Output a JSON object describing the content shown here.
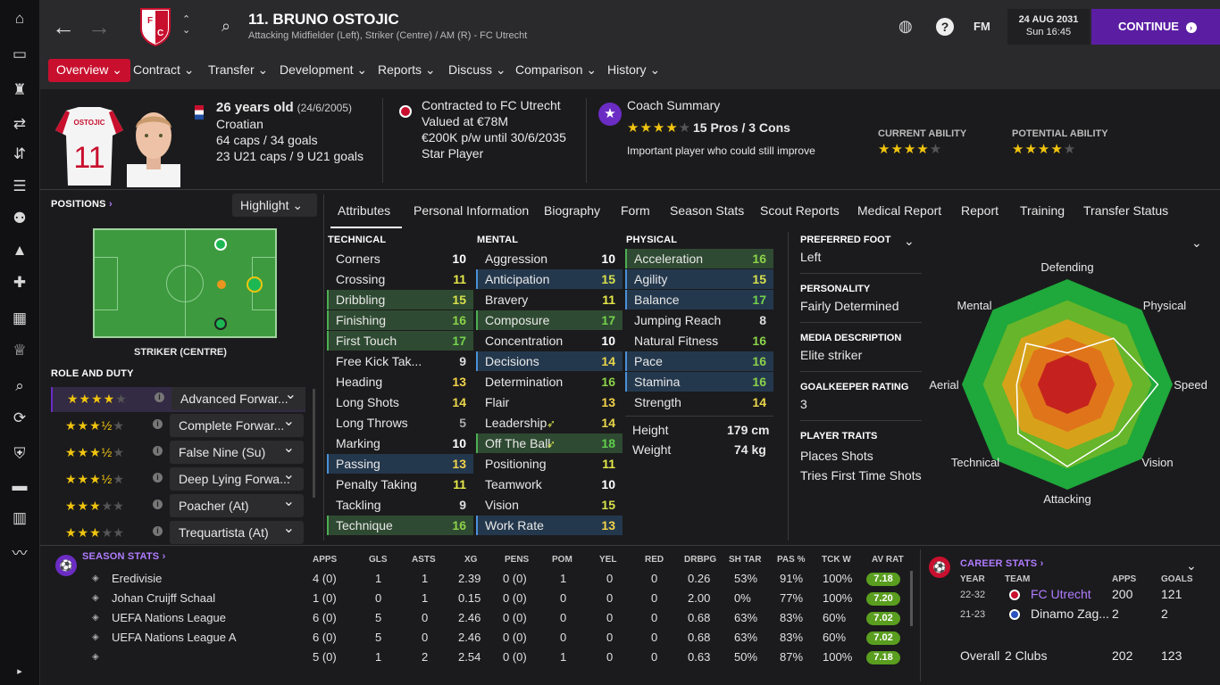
{
  "header": {
    "title": "11. BRUNO OSTOJIC",
    "subtitle": "Attacking Midfielder (Left), Striker (Centre) / AM (R) - FC Utrecht",
    "fm_label": "FM",
    "date": "24 AUG 2031",
    "time": "Sun 16:45",
    "continue_label": "CONTINUE"
  },
  "tabs": [
    "Overview",
    "Contract",
    "Transfer",
    "Development",
    "Reports",
    "Discuss",
    "Comparison",
    "History"
  ],
  "profile": {
    "shirt_name": "OSTOJIC",
    "shirt_number": "11",
    "age": "26 years old",
    "dob": "(24/6/2005)",
    "nationality": "Croatian",
    "caps": "64 caps / 34 goals",
    "u21_caps": "23 U21 caps / 9 U21 goals",
    "contract": "Contracted to FC Utrecht",
    "value": "Valued at €78M",
    "wage": "€200K p/w until 30/6/2035",
    "status": "Star Player",
    "coach_title": "Coach Summary",
    "coach_stars": "★★★★",
    "coach_stars_dim": "★",
    "pros_cons": "15 Pros / 3 Cons",
    "coach_note": "Important player who could still improve",
    "ca_label": "CURRENT ABILITY",
    "pa_label": "POTENTIAL ABILITY",
    "ca_stars": "★★★★",
    "ca_dim": "★",
    "pa_stars": "★★★★",
    "pa_dim": "★",
    "ca_value": 4,
    "pa_value": 4
  },
  "positions": {
    "title": "POSITIONS",
    "highlight": "Highlight",
    "position_label": "STRIKER (CENTRE)",
    "role_title": "ROLE AND DUTY",
    "roles": [
      {
        "stars": "★★★★",
        "dim": "★",
        "name": "Advanced Forwar..."
      },
      {
        "stars": "★★★½",
        "dim": "★",
        "name": "Complete Forwar..."
      },
      {
        "stars": "★★★½",
        "dim": "★",
        "name": "False Nine (Su)"
      },
      {
        "stars": "★★★½",
        "dim": "★",
        "name": "Deep Lying Forwa..."
      },
      {
        "stars": "★★★",
        "dim": "★★",
        "name": "Poacher (At)"
      },
      {
        "stars": "★★★",
        "dim": "★★",
        "name": "Trequartista (At)"
      }
    ]
  },
  "subtabs": [
    "Attributes",
    "Personal Information",
    "Biography",
    "Form",
    "Season Stats",
    "Scout Reports",
    "Medical Report",
    "Report",
    "Training",
    "Transfer Status"
  ],
  "technical": {
    "title": "TECHNICAL",
    "rows": [
      {
        "n": "Corners",
        "v": "10",
        "h": ""
      },
      {
        "n": "Crossing",
        "v": "11",
        "h": ""
      },
      {
        "n": "Dribbling",
        "v": "15",
        "h": "g"
      },
      {
        "n": "Finishing",
        "v": "16",
        "h": "g"
      },
      {
        "n": "First Touch",
        "v": "17",
        "h": "g"
      },
      {
        "n": "Free Kick Tak...",
        "v": "9",
        "h": ""
      },
      {
        "n": "Heading",
        "v": "13",
        "h": ""
      },
      {
        "n": "Long Shots",
        "v": "14",
        "h": ""
      },
      {
        "n": "Long Throws",
        "v": "5",
        "h": ""
      },
      {
        "n": "Marking",
        "v": "10",
        "h": ""
      },
      {
        "n": "Passing",
        "v": "13",
        "h": "b"
      },
      {
        "n": "Penalty Taking",
        "v": "11",
        "h": ""
      },
      {
        "n": "Tackling",
        "v": "9",
        "h": ""
      },
      {
        "n": "Technique",
        "v": "16",
        "h": "g"
      }
    ]
  },
  "mental": {
    "title": "MENTAL",
    "rows": [
      {
        "n": "Aggression",
        "v": "10",
        "h": ""
      },
      {
        "n": "Anticipation",
        "v": "15",
        "h": "b"
      },
      {
        "n": "Bravery",
        "v": "11",
        "h": ""
      },
      {
        "n": "Composure",
        "v": "17",
        "h": "g"
      },
      {
        "n": "Concentration",
        "v": "10",
        "h": ""
      },
      {
        "n": "Decisions",
        "v": "14",
        "h": "b"
      },
      {
        "n": "Determination",
        "v": "16",
        "h": ""
      },
      {
        "n": "Flair",
        "v": "13",
        "h": ""
      },
      {
        "n": "Leadership",
        "v": "14",
        "h": ""
      },
      {
        "n": "Off The Ball",
        "v": "18",
        "h": "g"
      },
      {
        "n": "Positioning",
        "v": "11",
        "h": ""
      },
      {
        "n": "Teamwork",
        "v": "10",
        "h": ""
      },
      {
        "n": "Vision",
        "v": "15",
        "h": ""
      },
      {
        "n": "Work Rate",
        "v": "13",
        "h": "b"
      }
    ]
  },
  "physical": {
    "title": "PHYSICAL",
    "rows": [
      {
        "n": "Acceleration",
        "v": "16",
        "h": "g"
      },
      {
        "n": "Agility",
        "v": "15",
        "h": "b"
      },
      {
        "n": "Balance",
        "v": "17",
        "h": "b"
      },
      {
        "n": "Jumping Reach",
        "v": "8",
        "h": ""
      },
      {
        "n": "Natural Fitness",
        "v": "16",
        "h": ""
      },
      {
        "n": "Pace",
        "v": "16",
        "h": "b"
      },
      {
        "n": "Stamina",
        "v": "16",
        "h": "b"
      },
      {
        "n": "Strength",
        "v": "14",
        "h": ""
      }
    ],
    "height_label": "Height",
    "height": "179 cm",
    "weight_label": "Weight",
    "weight": "74 kg"
  },
  "info": {
    "foot_label": "PREFERRED FOOT",
    "foot": "Left",
    "personality_label": "PERSONALITY",
    "personality": "Fairly Determined",
    "media_label": "MEDIA DESCRIPTION",
    "media": "Elite striker",
    "gk_label": "GOALKEEPER RATING",
    "gk": "3",
    "traits_label": "PLAYER TRAITS",
    "trait1": "Places Shots",
    "trait2": "Tries First Time Shots"
  },
  "radar": {
    "labels": [
      "Defending",
      "Physical",
      "Speed",
      "Vision",
      "Attacking",
      "Technical",
      "Aerial",
      "Mental"
    ],
    "values": [
      0.3,
      0.62,
      0.86,
      0.68,
      0.78,
      0.66,
      0.48,
      0.55
    ]
  },
  "season_stats": {
    "title": "SEASON STATS",
    "headers": [
      "APPS",
      "GLS",
      "ASTS",
      "XG",
      "PENS",
      "POM",
      "YEL",
      "RED",
      "DRBPG",
      "SH TAR",
      "PAS %",
      "TCK W",
      "AV RAT"
    ],
    "rows": [
      {
        "comp": "Eredivisie",
        "vals": [
          "4 (0)",
          "1",
          "1",
          "2.39",
          "0 (0)",
          "1",
          "0",
          "0",
          "0.26",
          "53%",
          "91%",
          "100%"
        ],
        "rat": "7.18"
      },
      {
        "comp": "Johan Cruijff Schaal",
        "vals": [
          "1 (0)",
          "0",
          "1",
          "0.15",
          "0 (0)",
          "0",
          "0",
          "0",
          "2.00",
          "0%",
          "77%",
          "100%"
        ],
        "rat": "7.20"
      },
      {
        "comp": "UEFA Nations League",
        "vals": [
          "6 (0)",
          "5",
          "0",
          "2.46",
          "0 (0)",
          "0",
          "0",
          "0",
          "0.68",
          "63%",
          "83%",
          "60%"
        ],
        "rat": "7.02"
      },
      {
        "comp": "UEFA Nations League A",
        "vals": [
          "6 (0)",
          "5",
          "0",
          "2.46",
          "0 (0)",
          "0",
          "0",
          "0",
          "0.68",
          "63%",
          "83%",
          "60%"
        ],
        "rat": "7.02"
      },
      {
        "comp": "",
        "vals": [
          "5 (0)",
          "1",
          "2",
          "2.54",
          "0 (0)",
          "1",
          "0",
          "0",
          "0.63",
          "50%",
          "87%",
          "100%"
        ],
        "rat": "7.18"
      }
    ]
  },
  "career": {
    "title": "CAREER STATS",
    "h_year": "YEAR",
    "h_team": "TEAM",
    "h_apps": "APPS",
    "h_goals": "GOALS",
    "rows": [
      {
        "year": "22-32",
        "team": "FC Utrecht",
        "apps": "200",
        "goals": "121"
      },
      {
        "year": "21-23",
        "team": "Dinamo Zag...",
        "apps": "2",
        "goals": "2"
      }
    ],
    "overall": "Overall",
    "clubs": "2 Clubs",
    "total_apps": "202",
    "total_goals": "123"
  }
}
